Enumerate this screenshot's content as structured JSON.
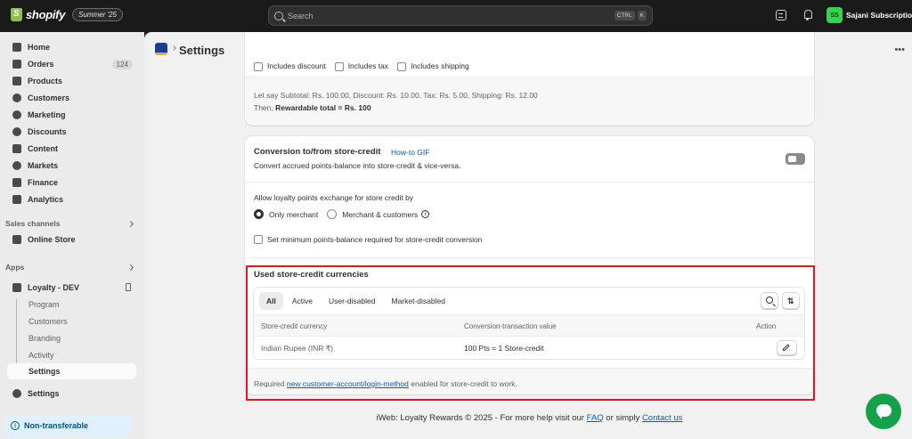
{
  "topbar": {
    "brand": "shopify",
    "edition_badge": "Summer '25",
    "search_placeholder": "Search",
    "shortcut_keys": [
      "CTRL",
      "K"
    ],
    "user_initials": "SS",
    "user_name": "Sajani Subscription"
  },
  "sidebar": {
    "items": [
      {
        "label": "Home",
        "icon": "home-icon"
      },
      {
        "label": "Orders",
        "icon": "orders-icon",
        "count": "124"
      },
      {
        "label": "Products",
        "icon": "products-icon"
      },
      {
        "label": "Customers",
        "icon": "customers-icon"
      },
      {
        "label": "Marketing",
        "icon": "marketing-icon"
      },
      {
        "label": "Discounts",
        "icon": "discounts-icon"
      },
      {
        "label": "Content",
        "icon": "content-icon"
      },
      {
        "label": "Markets",
        "icon": "markets-icon"
      },
      {
        "label": "Finance",
        "icon": "finance-icon"
      },
      {
        "label": "Analytics",
        "icon": "analytics-icon"
      }
    ],
    "sales_channels_label": "Sales channels",
    "online_store": "Online Store",
    "apps_label": "Apps",
    "app_name": "Loyalty - DEV",
    "app_subitems": [
      "Program",
      "Customers",
      "Branding",
      "Activity",
      "Settings"
    ],
    "settings": "Settings",
    "plan_badge": "Non-transferable"
  },
  "main": {
    "page_title": "Settings",
    "more_label": "•••",
    "card1": {
      "checkbox_labels": [
        "Includes discount",
        "Includes tax",
        "Includes shipping"
      ],
      "example_line": "Let say Subtotal: Rs. 100.00, Discount: Rs. 10.00, Tax: Rs. 5.00, Shipping: Rs. 12.00",
      "then_prefix": "Then, ",
      "rewardable_total": "Rewardable total = Rs. 100"
    },
    "conversion": {
      "title": "Conversion to/from store-credit",
      "howto_link": "How-to GIF",
      "description": "Convert accrued points-balance into store-credit & vice-versa.",
      "toggle_on": false,
      "exchange_label": "Allow loyalty points exchange for store credit by",
      "radio_options": [
        "Only merchant",
        "Merchant & customers"
      ],
      "selected_option": "Only merchant",
      "min_balance_label": "Set minimum points-balance required for store-credit conversion"
    },
    "currencies": {
      "title": "Used store-credit currencies",
      "tabs": [
        "All",
        "Active",
        "User-disabled",
        "Market-disabled"
      ],
      "active_tab": "All",
      "columns": [
        "Store-credit currency",
        "Conversion-transaction value",
        "Action"
      ],
      "rows": [
        {
          "currency": "Indian Rupee (INR ₹)",
          "value": "100 Pts = 1 Store-credit"
        }
      ],
      "footer_prefix": "Required ",
      "footer_link": "new customer-account/login-method",
      "footer_suffix": " enabled for store-credit to work."
    },
    "footer": {
      "prefix": "iWeb: Loyalty Rewards © 2025 - For more help visit our ",
      "faq": "FAQ",
      "middle": " or simply ",
      "contact": "Contact us"
    }
  },
  "colors": {
    "topbar_bg": "#1a1a1a",
    "highlight_border": "#e3161c",
    "link": "#005bd3",
    "chat_green": "#15a04a",
    "avatar_green": "#36d44e"
  }
}
